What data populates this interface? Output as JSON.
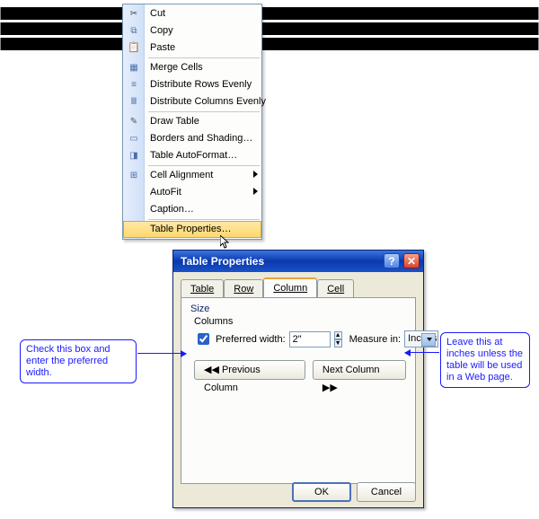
{
  "context_menu": {
    "cut": "Cut",
    "copy": "Copy",
    "paste": "Paste",
    "merge_cells": "Merge Cells",
    "distribute_rows": "Distribute Rows Evenly",
    "distribute_cols": "Distribute Columns Evenly",
    "draw_table": "Draw Table",
    "borders_shading": "Borders and Shading…",
    "table_autoformat": "Table AutoFormat…",
    "cell_alignment": "Cell Alignment",
    "autofit": "AutoFit",
    "caption": "Caption…",
    "table_properties": "Table Properties…"
  },
  "dialog": {
    "title": "Table Properties",
    "tabs": {
      "table": "Table",
      "row": "Row",
      "column": "Column",
      "cell": "Cell"
    },
    "size_label": "Size",
    "columns_label": "Columns",
    "preferred_width_label": "Preferred width:",
    "preferred_width_value": "2\"",
    "measure_in_label": "Measure in:",
    "measure_in_value": "Inches",
    "prev_col": "◀◀ Previous Column",
    "next_col": "Next Column ▶▶",
    "ok": "OK",
    "cancel": "Cancel"
  },
  "callouts": {
    "left": "Check this box and enter the preferred width.",
    "right": "Leave this at inches unless the table will be used in a Web page."
  }
}
